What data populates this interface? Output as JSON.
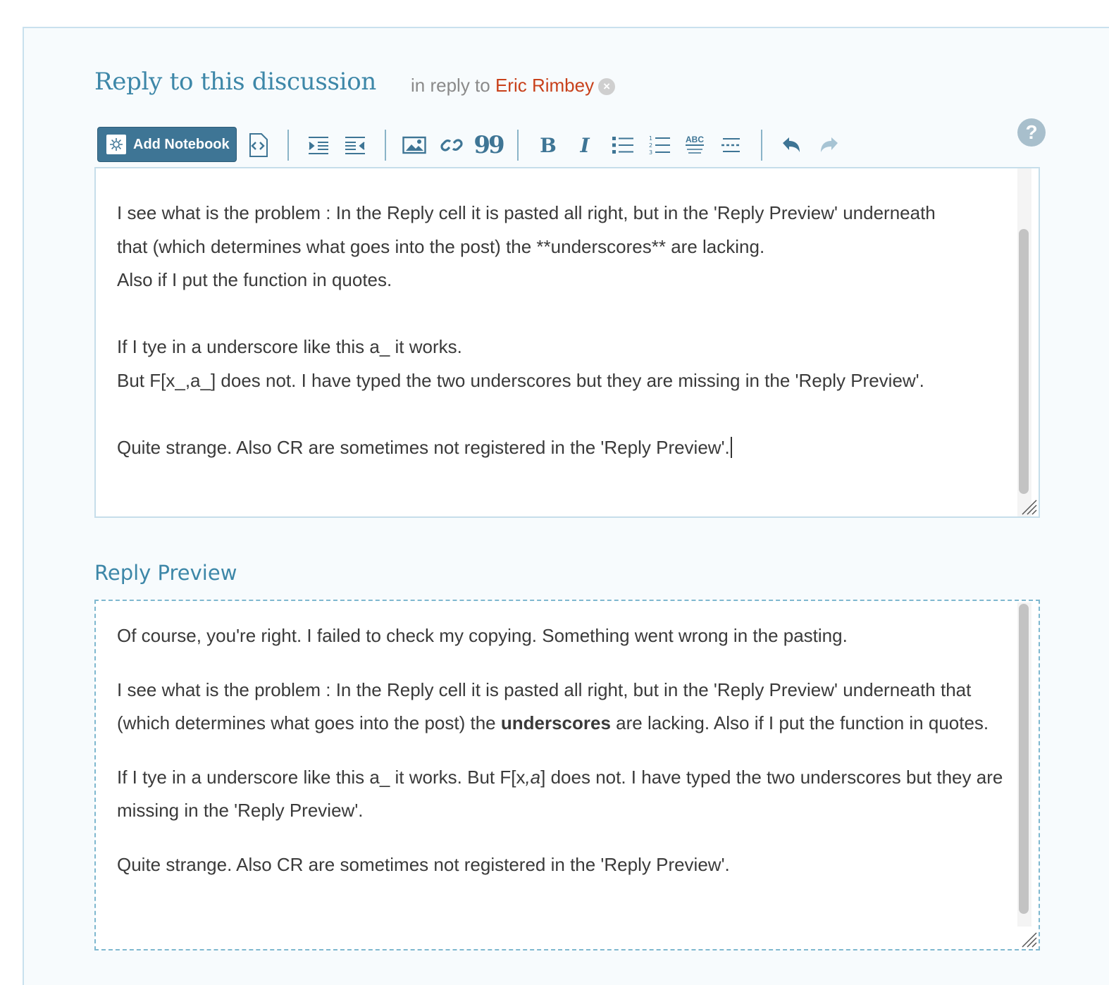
{
  "header": {
    "title": "Reply to this discussion",
    "in_reply_prefix": "in reply to",
    "in_reply_name": "Eric Rimbey",
    "clear_glyph": "×",
    "help_glyph": "?"
  },
  "toolbar": {
    "add_notebook_label": "Add Notebook",
    "buttons": [
      "code-icon",
      "indent-icon",
      "outdent-icon",
      "image-icon",
      "link-icon",
      "quote-icon",
      "bold-icon",
      "italic-icon",
      "bullet-list-icon",
      "numbered-list-icon",
      "strikethrough-icon",
      "horizontal-rule-icon",
      "undo-icon",
      "redo-icon"
    ],
    "bold_glyph": "B",
    "italic_glyph": "I",
    "quote_glyph": "99",
    "strike_glyph": "ABC"
  },
  "editor": {
    "line1": "I see what is the problem : In the Reply cell it is pasted all right, but in the 'Reply Preview' underneath",
    "line2": "that (which determines what goes into the post) the **underscores** are lacking.",
    "line3": "Also if I put the function in quotes.",
    "line4": "If I tye in a  underscore like this a_ it works.",
    "line5": "But F[x_,a_]  does not. I have typed the two underscores but they are missing in the 'Reply Preview'.",
    "line6": "Quite strange. Also CR are sometimes not registered in the 'Reply Preview'."
  },
  "preview": {
    "title": "Reply Preview",
    "p1": "Of course, you're right. I failed to check my copying. Something went wrong in the pasting.",
    "p2_before": "I see what is the problem : In the Reply cell it is pasted all right, but in the 'Reply Preview' underneath that (which determines what goes into the post) the ",
    "p2_bold": "underscores",
    "p2_after": " are lacking. Also if I put the function in quotes.",
    "p3_before": "If I tye in a underscore like this a_ it works. But F[x",
    "p3_italic": ",a",
    "p3_after": "] does not. I have typed the two underscores but they are missing in the 'Reply Preview'.",
    "p4": "Quite strange. Also CR are sometimes not registered in the 'Reply Preview'."
  },
  "colors": {
    "accent": "#3d87a8",
    "reply_name": "#c8411b",
    "button_bg": "#3e7595",
    "icon": "#3e7595"
  }
}
